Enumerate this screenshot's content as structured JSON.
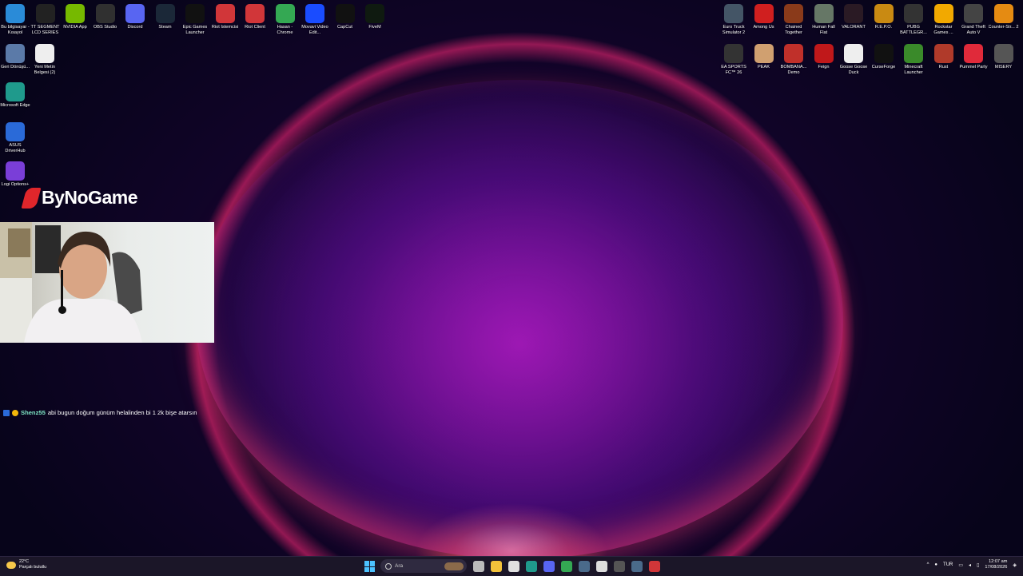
{
  "desktop_icons_left_row": [
    {
      "label": "Bu bilgisayar - Kısayol",
      "icon": "computer-icon",
      "color": "#2a8bd8"
    },
    {
      "label": "TT SEGMENT LCD SERIES",
      "icon": "tt-icon",
      "color": "#222222"
    },
    {
      "label": "NVIDIA App",
      "icon": "nvidia-icon",
      "color": "#76b900"
    },
    {
      "label": "OBS Studio",
      "icon": "obs-icon",
      "color": "#303030"
    },
    {
      "label": "Discord",
      "icon": "discord-icon",
      "color": "#5865f2"
    },
    {
      "label": "Steam",
      "icon": "steam-icon",
      "color": "#1b2838"
    },
    {
      "label": "Epic Games Launcher",
      "icon": "epic-icon",
      "color": "#111111"
    },
    {
      "label": "Riot İstemcisi",
      "icon": "riot-icon",
      "color": "#d13639"
    },
    {
      "label": "Riot Client",
      "icon": "riot-icon",
      "color": "#d13639"
    },
    {
      "label": "Hasan - Chrome",
      "icon": "chrome-icon",
      "color": "#34a853"
    },
    {
      "label": "Movavi Video Edit...",
      "icon": "movavi-icon",
      "color": "#1a4cff"
    },
    {
      "label": "CapCut",
      "icon": "capcut-icon",
      "color": "#111111"
    },
    {
      "label": "FiveM",
      "icon": "fivem-icon",
      "color": "#0f1a10"
    }
  ],
  "desktop_icons_left_col": [
    {
      "label": "Geri Dönüşü...",
      "icon": "recycle-bin-icon",
      "color": "#5b7aa8"
    },
    {
      "label": "Yeni Metin Belgesi (2)",
      "icon": "text-document-icon",
      "color": "#eeeeee"
    },
    {
      "label": "Microsoft Edge",
      "icon": "edge-icon",
      "color": "#1f9a8c"
    },
    {
      "label": "ASUS DriverHub",
      "icon": "asus-icon",
      "color": "#2a6ad8"
    },
    {
      "label": "Logi Options+",
      "icon": "logi-icon",
      "color": "#7a3ed8"
    }
  ],
  "desktop_icons_right_row1": [
    {
      "label": "Euro Truck Simulator 2",
      "icon": "ets2-icon",
      "color": "#445566"
    },
    {
      "label": "Among Us",
      "icon": "among-us-icon",
      "color": "#d01f1f"
    },
    {
      "label": "Chained Together",
      "icon": "chained-together-icon",
      "color": "#8a3a1a"
    },
    {
      "label": "Human Fall Flat",
      "icon": "human-fall-flat-icon",
      "color": "#667766"
    },
    {
      "label": "VALORANT",
      "icon": "valorant-icon",
      "color": "#2a1a24"
    },
    {
      "label": "R.E.P.O.",
      "icon": "repo-icon",
      "color": "#c98a12"
    },
    {
      "label": "PUBG BATTLEGR...",
      "icon": "pubg-icon",
      "color": "#333333"
    },
    {
      "label": "Rockstar Games ...",
      "icon": "rockstar-icon",
      "color": "#f2a900"
    },
    {
      "label": "Grand Theft Auto V",
      "icon": "gta-icon",
      "color": "#444444"
    },
    {
      "label": "Counter-Str... 2",
      "icon": "cs2-icon",
      "color": "#e58b12"
    }
  ],
  "desktop_icons_right_row2": [
    {
      "label": "EA SPORTS FC™ 26",
      "icon": "ea-fc-icon",
      "color": "#333333"
    },
    {
      "label": "PEAK",
      "icon": "peak-icon",
      "color": "#d0a070"
    },
    {
      "label": "BOMBANA... Demo",
      "icon": "bombana-icon",
      "color": "#c0302a"
    },
    {
      "label": "Feign",
      "icon": "feign-icon",
      "color": "#c0181a"
    },
    {
      "label": "Goose Goose Duck",
      "icon": "goose-icon",
      "color": "#eeeeee"
    },
    {
      "label": "CurseForge",
      "icon": "curseforge-icon",
      "color": "#111111"
    },
    {
      "label": "Minecraft Launcher",
      "icon": "minecraft-icon",
      "color": "#3a8a2a"
    },
    {
      "label": "Rust",
      "icon": "rust-icon",
      "color": "#b03a2a"
    },
    {
      "label": "Pummel Party",
      "icon": "pummel-party-icon",
      "color": "#e02a3a"
    },
    {
      "label": "MISERY",
      "icon": "misery-icon",
      "color": "#555555"
    }
  ],
  "overlay": {
    "brand": "ByNoGame",
    "chat": {
      "user": "Shenz55",
      "message": "abi bugun doğum günüm helalinden bi 1 2k bişe atarsın"
    }
  },
  "taskbar": {
    "weather_temp": "22°C",
    "weather_desc": "Parçalı bulutlu",
    "search_placeholder": "Ara",
    "language": "TUR",
    "time": "12:07 am",
    "date": "17/08/2026",
    "pinned": [
      {
        "name": "task-view-icon",
        "color": "#bbbbbb"
      },
      {
        "name": "explorer-icon",
        "color": "#f3c23a"
      },
      {
        "name": "store-icon",
        "color": "#e0e0e0"
      },
      {
        "name": "edge-icon",
        "color": "#1f9a8c"
      },
      {
        "name": "discord-icon",
        "color": "#5865f2"
      },
      {
        "name": "chrome-icon",
        "color": "#34a853"
      },
      {
        "name": "steam-icon",
        "color": "#4a6a8a"
      },
      {
        "name": "epic-icon",
        "color": "#dddddd"
      },
      {
        "name": "obs-icon",
        "color": "#555555"
      },
      {
        "name": "steam-alt-icon",
        "color": "#4a6a8a"
      },
      {
        "name": "riot-icon",
        "color": "#d13639"
      }
    ]
  }
}
